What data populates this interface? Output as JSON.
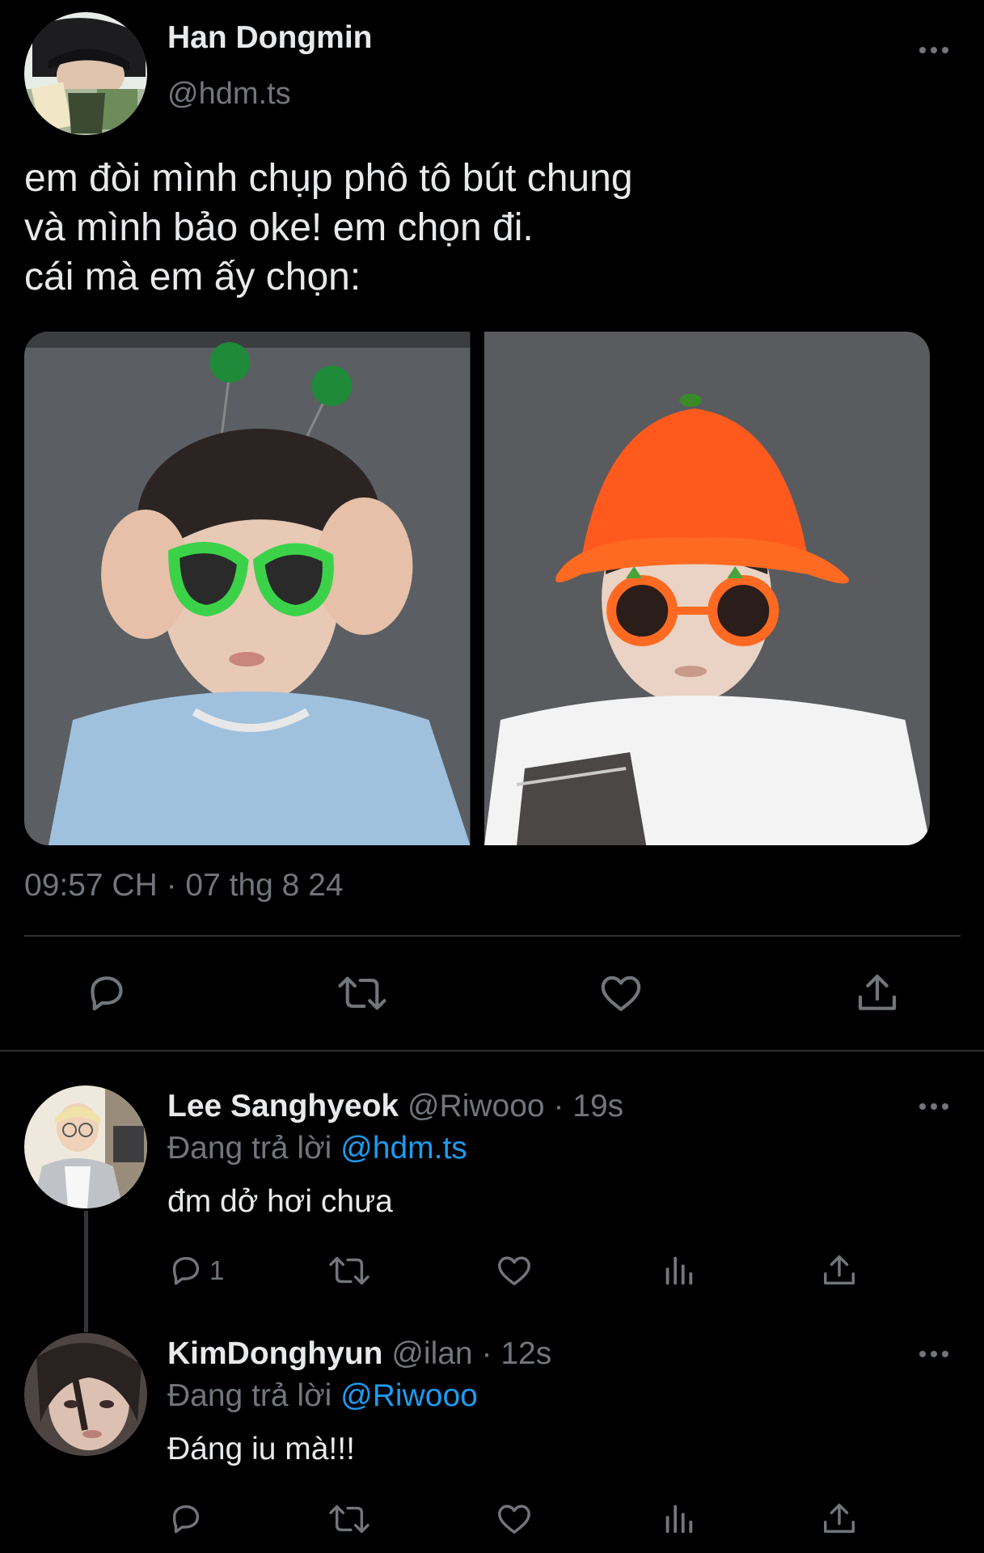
{
  "tweet": {
    "author_name": "Han Dongmin",
    "author_handle": "@hdm.ts",
    "text": "em đòi mình chụp phô tô bút chung\nvà mình bảo oke! em chọn đi.\ncái mà em ấy chọn:",
    "timestamp": "09:57 CH · 07 thg 8 24",
    "photos": [
      "photo-green-alien-headband",
      "photo-orange-bucket-hat"
    ],
    "actions": [
      "reply-icon",
      "retweet-icon",
      "like-icon",
      "share-icon"
    ]
  },
  "replies": [
    {
      "name": "Lee Sanghyeok",
      "handle": "@Riwooo",
      "sep": "·",
      "time": "19s",
      "replying_prefix": "Đang trả lời",
      "replying_to": "@hdm.ts",
      "text": "đm dở hơi chưa",
      "reply_count": "1",
      "actions": [
        "reply-icon",
        "retweet-icon",
        "like-icon",
        "analytics-icon",
        "share-icon"
      ]
    },
    {
      "name": "KimDonghyun",
      "handle": "@ilan",
      "sep": "·",
      "time": "12s",
      "replying_prefix": "Đang trả lời",
      "replying_to": "@Riwooo",
      "text": "Đáng iu mà!!!",
      "reply_count": "",
      "actions": [
        "reply-icon",
        "retweet-icon",
        "like-icon",
        "analytics-icon",
        "share-icon"
      ]
    }
  ],
  "colors": {
    "background": "#000000",
    "text": "#e7e9ea",
    "muted": "#71767b",
    "link": "#1d9bf0",
    "divider": "#2f3336"
  }
}
